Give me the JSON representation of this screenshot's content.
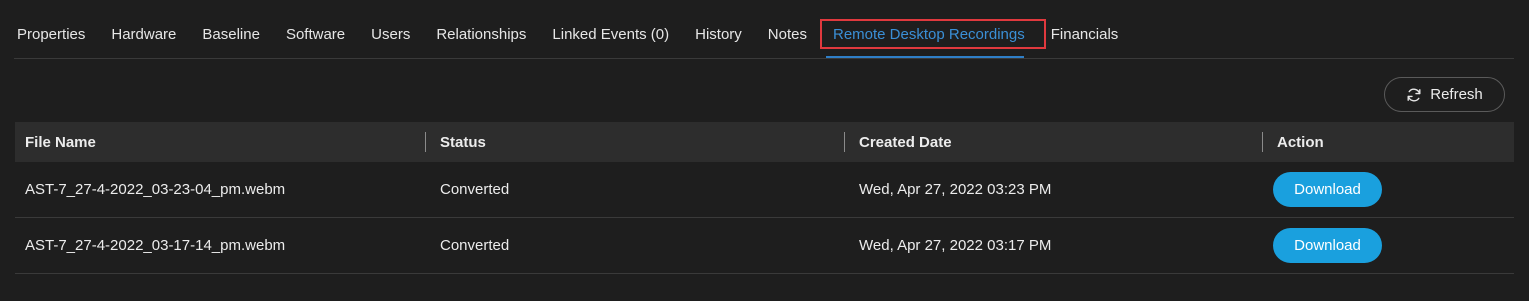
{
  "tabs": [
    {
      "label": "Properties",
      "active": false
    },
    {
      "label": "Hardware",
      "active": false
    },
    {
      "label": "Baseline",
      "active": false
    },
    {
      "label": "Software",
      "active": false
    },
    {
      "label": "Users",
      "active": false
    },
    {
      "label": "Relationships",
      "active": false
    },
    {
      "label": "Linked Events (0)",
      "active": false
    },
    {
      "label": "History",
      "active": false
    },
    {
      "label": "Notes",
      "active": false
    },
    {
      "label": "Remote Desktop Recordings",
      "active": true
    },
    {
      "label": "Financials",
      "active": false
    }
  ],
  "toolbar": {
    "refresh_label": "Refresh",
    "refresh_icon": "refresh-icon"
  },
  "table": {
    "columns": [
      "File Name",
      "Status",
      "Created Date",
      "Action"
    ],
    "rows": [
      {
        "file_name": "AST-7_27-4-2022_03-23-04_pm.webm",
        "status": "Converted",
        "created_date": "Wed, Apr 27, 2022 03:23 PM",
        "action_label": "Download"
      },
      {
        "file_name": "AST-7_27-4-2022_03-17-14_pm.webm",
        "status": "Converted",
        "created_date": "Wed, Apr 27, 2022 03:17 PM",
        "action_label": "Download"
      }
    ]
  },
  "colors": {
    "background": "#1e1e1e",
    "active_tab": "#3a8fd6",
    "highlight_box": "#e0393e",
    "download_button": "#1aa0de",
    "header_row": "#2d2d2d"
  }
}
